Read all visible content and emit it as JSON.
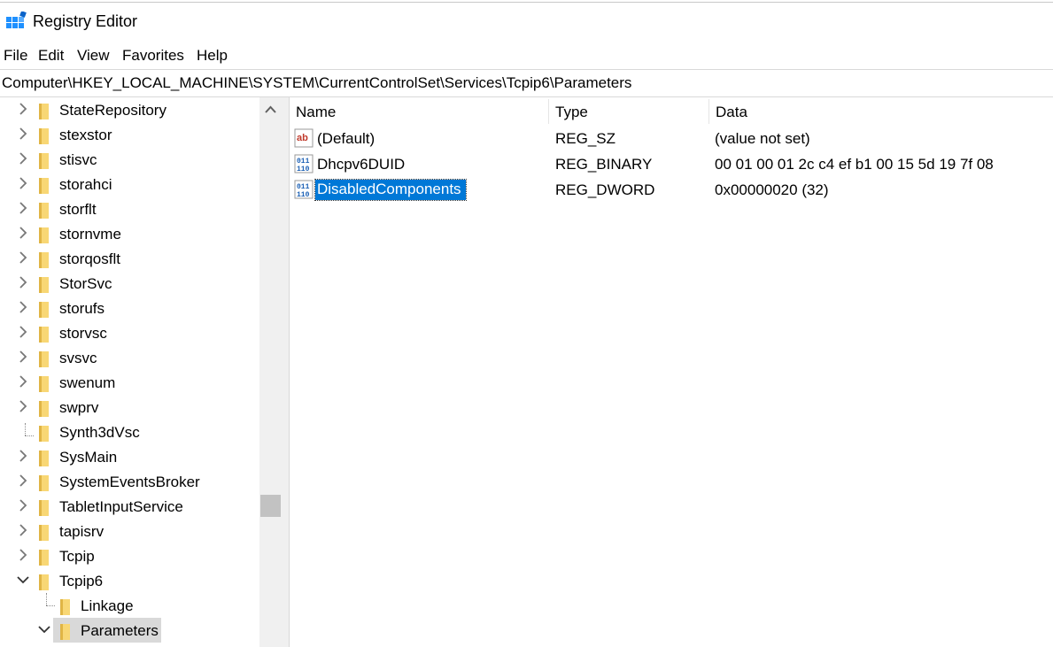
{
  "window": {
    "title": "Registry Editor"
  },
  "menu": [
    "File",
    "Edit",
    "View",
    "Favorites",
    "Help"
  ],
  "address": "Computer\\HKEY_LOCAL_MACHINE\\SYSTEM\\CurrentControlSet\\Services\\Tcpip6\\Parameters",
  "tree": {
    "items": [
      {
        "label": "StateRepository",
        "state": "collapsed"
      },
      {
        "label": "stexstor",
        "state": "collapsed"
      },
      {
        "label": "stisvc",
        "state": "collapsed"
      },
      {
        "label": "storahci",
        "state": "collapsed"
      },
      {
        "label": "storflt",
        "state": "collapsed"
      },
      {
        "label": "stornvme",
        "state": "collapsed"
      },
      {
        "label": "storqosflt",
        "state": "collapsed"
      },
      {
        "label": "StorSvc",
        "state": "collapsed"
      },
      {
        "label": "storufs",
        "state": "collapsed"
      },
      {
        "label": "storvsc",
        "state": "collapsed"
      },
      {
        "label": "svsvc",
        "state": "collapsed"
      },
      {
        "label": "swenum",
        "state": "collapsed"
      },
      {
        "label": "swprv",
        "state": "collapsed"
      },
      {
        "label": "Synth3dVsc",
        "state": "leaf"
      },
      {
        "label": "SysMain",
        "state": "collapsed"
      },
      {
        "label": "SystemEventsBroker",
        "state": "collapsed"
      },
      {
        "label": "TabletInputService",
        "state": "collapsed"
      },
      {
        "label": "tapisrv",
        "state": "collapsed"
      },
      {
        "label": "Tcpip",
        "state": "collapsed"
      },
      {
        "label": "Tcpip6",
        "state": "expanded"
      },
      {
        "label": "Linkage",
        "state": "leaf"
      },
      {
        "label": "Parameters",
        "state": "expanded",
        "selected": true
      }
    ]
  },
  "list": {
    "columns": [
      "Name",
      "Type",
      "Data"
    ],
    "rows": [
      {
        "name": "(Default)",
        "type": "REG_SZ",
        "data": "(value not set)",
        "icon": "string-value-icon"
      },
      {
        "name": "Dhcpv6DUID",
        "type": "REG_BINARY",
        "data": "00 01 00 01 2c c4 ef b1 00 15 5d 19 7f 08",
        "icon": "binary-value-icon"
      },
      {
        "name": "DisabledComponents",
        "type": "REG_DWORD",
        "data": "0x00000020 (32)",
        "icon": "binary-value-icon",
        "selected": true
      }
    ]
  },
  "colors": {
    "selection": "#0078d7",
    "tree_selection": "#d9d9d9",
    "folder": "#f8d775"
  }
}
